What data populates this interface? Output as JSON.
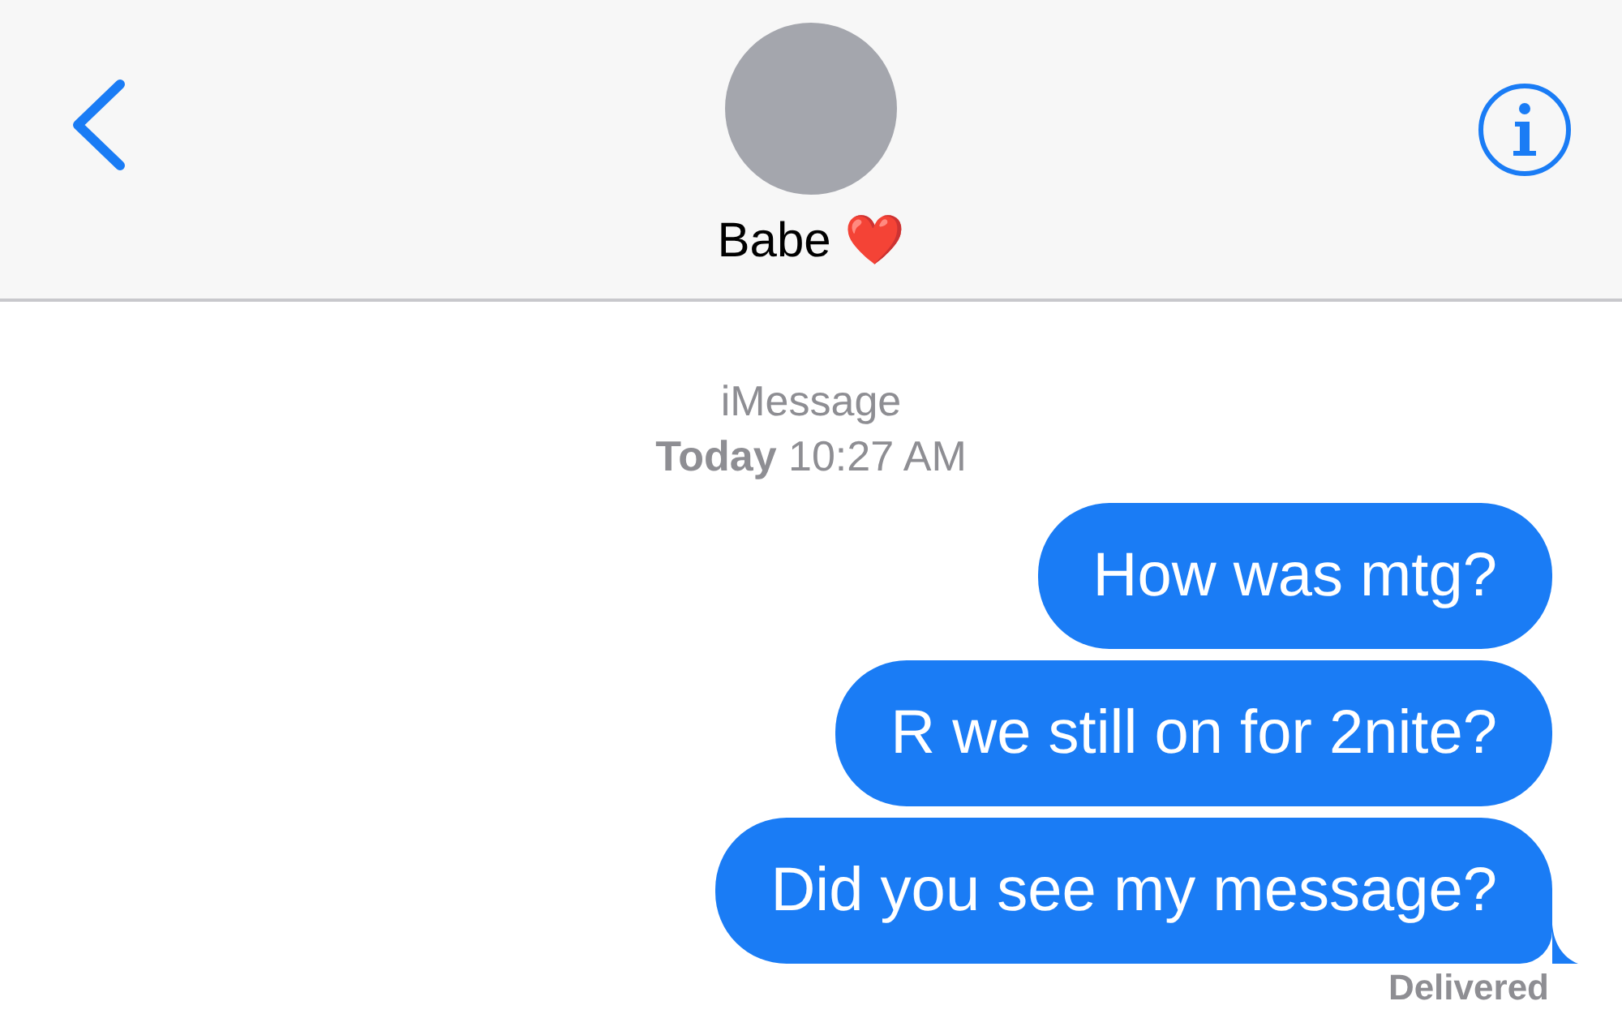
{
  "header": {
    "contact_name": "Babe ❤️"
  },
  "thread": {
    "service": "iMessage",
    "timestamp": "**Today** 10:27 AM",
    "messages": [
      {
        "kind": "sent",
        "text": "How was mtg?",
        "tail": false
      },
      {
        "kind": "sent",
        "text": "R we still on for 2nite?",
        "tail": false
      },
      {
        "kind": "sent",
        "text": "Did you see my message?",
        "tail": true
      }
    ],
    "receipt": "Delivered"
  }
}
